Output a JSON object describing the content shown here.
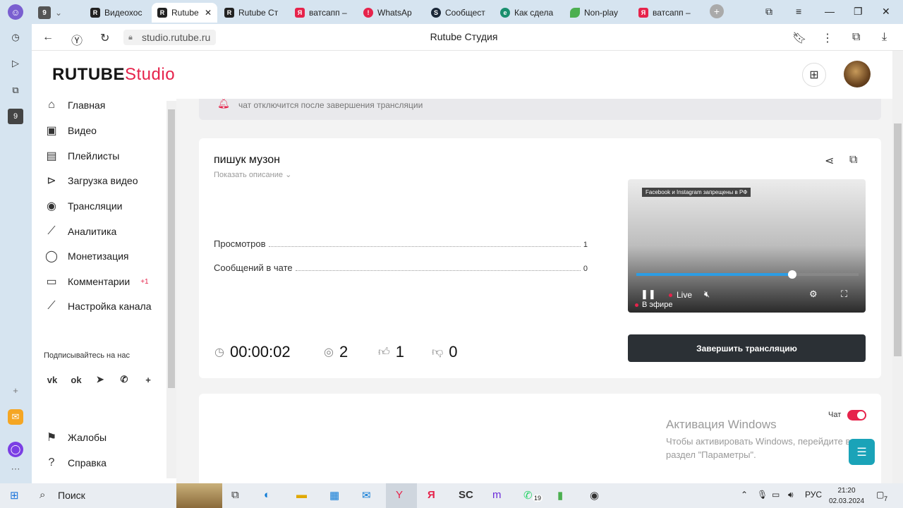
{
  "browser": {
    "tab_count_badge": "9",
    "tabs": [
      {
        "label": "Видеохос",
        "icon": "rutube-icon"
      },
      {
        "label": "Rutube",
        "icon": "rutube-icon",
        "active": true
      },
      {
        "label": "Rutube Ст",
        "icon": "rutube-icon"
      },
      {
        "label": "ватсапп –",
        "icon": "yandex-icon"
      },
      {
        "label": "WhatsAp",
        "icon": "whatsapp-icon"
      },
      {
        "label": "Сообщест",
        "icon": "steam-icon"
      },
      {
        "label": "Как сдела",
        "icon": "edge-icon"
      },
      {
        "label": "Non-play",
        "icon": "leaf-icon"
      },
      {
        "label": "ватсапп –",
        "icon": "yandex-icon"
      }
    ],
    "url": "studio.rutube.ru",
    "page_title": "Rutube Студия",
    "sidebar_badge": "9"
  },
  "header": {
    "logo_main": "RUTUBE",
    "logo_sub": "Studio"
  },
  "nav": {
    "items": [
      {
        "label": "Главная",
        "icon": "home-icon"
      },
      {
        "label": "Видео",
        "icon": "video-icon"
      },
      {
        "label": "Плейлисты",
        "icon": "playlist-icon"
      },
      {
        "label": "Загрузка видео",
        "icon": "upload-icon"
      },
      {
        "label": "Трансляции",
        "icon": "broadcast-icon"
      },
      {
        "label": "Аналитика",
        "icon": "analytics-icon"
      },
      {
        "label": "Монетизация",
        "icon": "monetization-icon"
      },
      {
        "label": "Комментарии",
        "icon": "comments-icon",
        "badge": "+1"
      },
      {
        "label": "Настройка канала",
        "icon": "wand-icon"
      }
    ],
    "subscribe_label": "Подписывайтесь на нас",
    "social": [
      "vk",
      "ok",
      "telegram",
      "viber",
      "+"
    ],
    "bottom_items": [
      {
        "label": "Жалобы",
        "icon": "flag-icon"
      },
      {
        "label": "Справка",
        "icon": "help-icon"
      }
    ]
  },
  "main": {
    "notice_text": "чат отключится после завершения трансляции",
    "stream": {
      "title": "пишук музон",
      "show_description": "Показать описание",
      "stats": [
        {
          "label": "Просмотров",
          "value": "1"
        },
        {
          "label": "Сообщений в чате",
          "value": "0"
        }
      ],
      "duration": "00:00:02",
      "viewers": "2",
      "likes": "1",
      "dislikes": "0",
      "player": {
        "banner": "Facebook и Instagram запрещены в РФ",
        "live_label": "Live",
        "on_air_label": "В эфире",
        "progress_fraction": 0.7
      },
      "end_button": "Завершить трансляцию"
    },
    "chat": {
      "label": "Чат",
      "enabled": true
    }
  },
  "windows_activation": {
    "title": "Активация Windows",
    "line1": "Чтобы активировать Windows, перейдите в",
    "line2": "раздел \"Параметры\"."
  },
  "taskbar": {
    "search_label": "Поиск",
    "whatsapp_badge": "19",
    "language": "РУС",
    "time": "21:20",
    "date": "02.03.2024",
    "notification_count": "7"
  },
  "colors": {
    "accent": "#e6234b",
    "dark_button": "#2b3035",
    "chat_fab": "#1aa3b8"
  }
}
